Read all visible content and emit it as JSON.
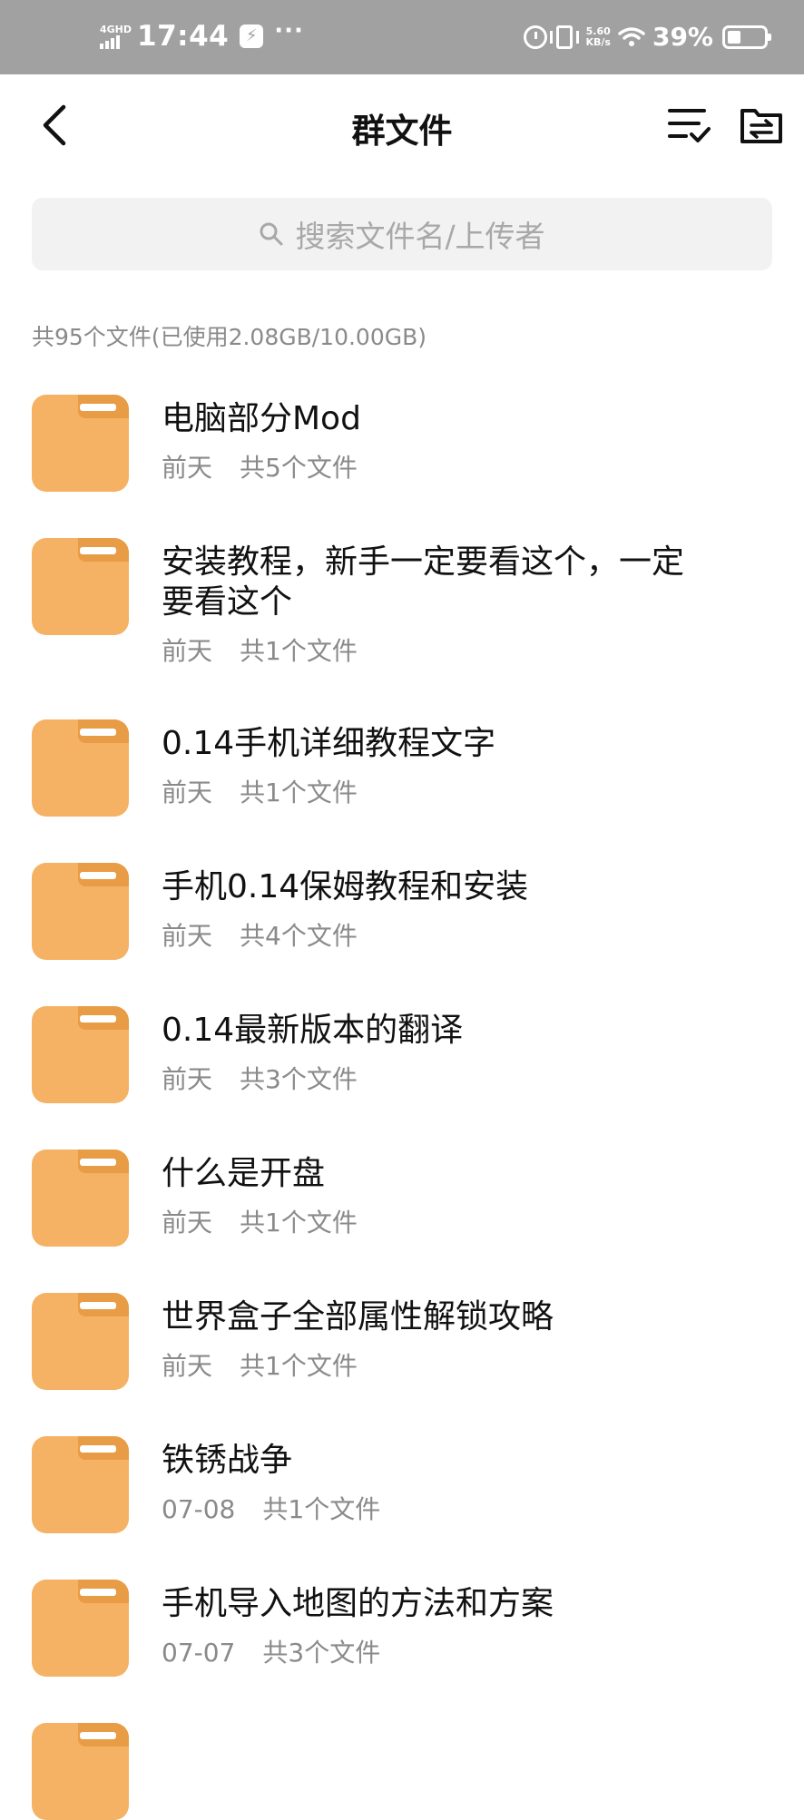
{
  "status_bar": {
    "network": "4GHD",
    "time": "17:44",
    "bolt": "⚡",
    "more": "···",
    "speed_value": "5.60",
    "speed_unit": "KB/s",
    "battery": "39%"
  },
  "header": {
    "title": "群文件"
  },
  "search": {
    "placeholder": "搜索文件名/上传者"
  },
  "summary": "共95个文件(已使用2.08GB/10.00GB)",
  "files": [
    {
      "name": "电脑部分Mod",
      "date": "前天",
      "count": "共5个文件"
    },
    {
      "name": "安装教程，新手一定要看这个，一定要看这个",
      "date": "前天",
      "count": "共1个文件"
    },
    {
      "name": "0.14手机详细教程文字",
      "date": "前天",
      "count": "共1个文件"
    },
    {
      "name": "手机0.14保姆教程和安装",
      "date": "前天",
      "count": "共4个文件"
    },
    {
      "name": "0.14最新版本的翻译",
      "date": "前天",
      "count": "共3个文件"
    },
    {
      "name": "什么是开盘",
      "date": "前天",
      "count": "共1个文件"
    },
    {
      "name": "世界盒子全部属性解锁攻略",
      "date": "前天",
      "count": "共1个文件"
    },
    {
      "name": "铁锈战争",
      "date": "07-08",
      "count": "共1个文件"
    },
    {
      "name": "手机导入地图的方法和方案",
      "date": "07-07",
      "count": "共3个文件"
    }
  ],
  "colors": {
    "folder": "#f5b264",
    "folder_tab": "#e89c45",
    "status_bar": "#a1a1a1"
  }
}
